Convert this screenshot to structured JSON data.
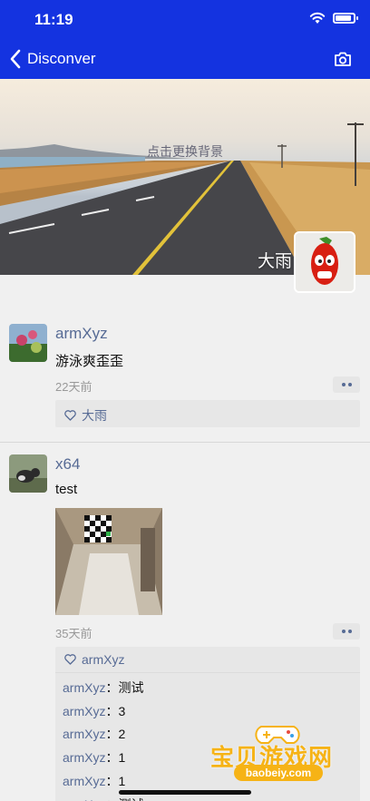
{
  "status_bar": {
    "time": "11:19"
  },
  "nav": {
    "back_label": "Disconver"
  },
  "cover": {
    "hint": "点击更换背景",
    "username": "大雨"
  },
  "posts": [
    {
      "user": "armXyz",
      "text": "游泳爽歪歪",
      "time": "22天前",
      "likes": [
        "大雨"
      ],
      "likes_text": "大雨"
    },
    {
      "user": "x64",
      "text": "test",
      "time": "35天前",
      "likes_text": "armXyz",
      "comments": [
        {
          "user": "armXyz",
          "sep": "：",
          "text": "测试"
        },
        {
          "user": "armXyz",
          "sep": "：",
          "text": "3"
        },
        {
          "user": "armXyz",
          "sep": "：",
          "text": "2"
        },
        {
          "user": "armXyz",
          "sep": "：",
          "text": "1"
        },
        {
          "user": "armXyz",
          "sep": "：",
          "text": "1"
        },
        {
          "user": "armXyz",
          "sep": "：",
          "text": "测试"
        }
      ]
    }
  ],
  "watermark": {
    "title": "宝贝游戏网",
    "url": "baobeiy.com"
  },
  "colors": {
    "nav_bg": "#1433e0",
    "link": "#576b95",
    "watermark": "#f6b316"
  },
  "icons": {
    "back": "chevron-left-icon",
    "camera": "camera-icon",
    "like": "heart-icon",
    "more": "more-dots-icon"
  }
}
